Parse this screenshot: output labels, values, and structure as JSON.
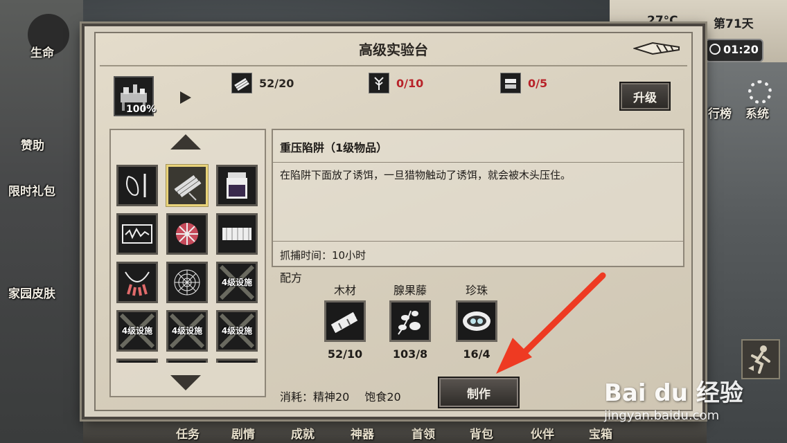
{
  "hud": {
    "life_label": "生命",
    "sponsor_label": "赞助",
    "gift_label": "限时礼包",
    "skin_label": "家园皮肤",
    "temperature": "27°C",
    "day": "第71天",
    "time": "01:20",
    "rank_label": "行榜",
    "system_label": "系统"
  },
  "bottom_tabs": [
    "任务",
    "剧情",
    "成就",
    "神器",
    "首领",
    "背包",
    "伙伴",
    "宝箱"
  ],
  "panel": {
    "title": "高级实验台",
    "facility_progress": "100%",
    "requirements": [
      {
        "icon": "wood-icon",
        "value": "52/20",
        "color": "#2a2622"
      },
      {
        "icon": "herb-icon",
        "value": "0/10",
        "color": "#b8232a"
      },
      {
        "icon": "metal-icon",
        "value": "0/5",
        "color": "#b8232a"
      }
    ],
    "upgrade_label": "升级"
  },
  "list": {
    "lock_label": "4级设施",
    "items": [
      {
        "icon": "snare-icon",
        "locked": false,
        "selected": false
      },
      {
        "icon": "log-trap-icon",
        "locked": false,
        "selected": true
      },
      {
        "icon": "jar-icon",
        "locked": false,
        "selected": false
      },
      {
        "icon": "radio-icon",
        "locked": false,
        "selected": false
      },
      {
        "icon": "shell-icon",
        "locked": false,
        "selected": false
      },
      {
        "icon": "fence-icon",
        "locked": false,
        "selected": false
      },
      {
        "icon": "necklace-icon",
        "locked": false,
        "selected": false
      },
      {
        "icon": "web-icon",
        "locked": false,
        "selected": false
      },
      {
        "icon": "locked-icon",
        "locked": true,
        "selected": false
      },
      {
        "icon": "locked-icon",
        "locked": true,
        "selected": false
      },
      {
        "icon": "locked-icon",
        "locked": true,
        "selected": false
      },
      {
        "icon": "locked-icon",
        "locked": true,
        "selected": false
      }
    ]
  },
  "detail": {
    "name": "重压陷阱（1级物品）",
    "description": "在陷阱下面放了诱饵，一旦猎物触动了诱饵，就会被木头压住。",
    "catch_time": "抓捕时间：10小时"
  },
  "recipe": {
    "label": "配方",
    "ingredients": [
      {
        "name": "木材",
        "count": "52/10",
        "icon": "wood-bundle-icon"
      },
      {
        "name": "腺果藤",
        "count": "103/8",
        "icon": "vine-icon"
      },
      {
        "name": "珍珠",
        "count": "16/4",
        "icon": "pearl-icon"
      }
    ]
  },
  "consume": {
    "spirit": "消耗：精神20",
    "food": "饱食20"
  },
  "make_label": "制作",
  "watermark": {
    "text": "Bai du 经验",
    "url": "jingyan.baidu.com"
  }
}
